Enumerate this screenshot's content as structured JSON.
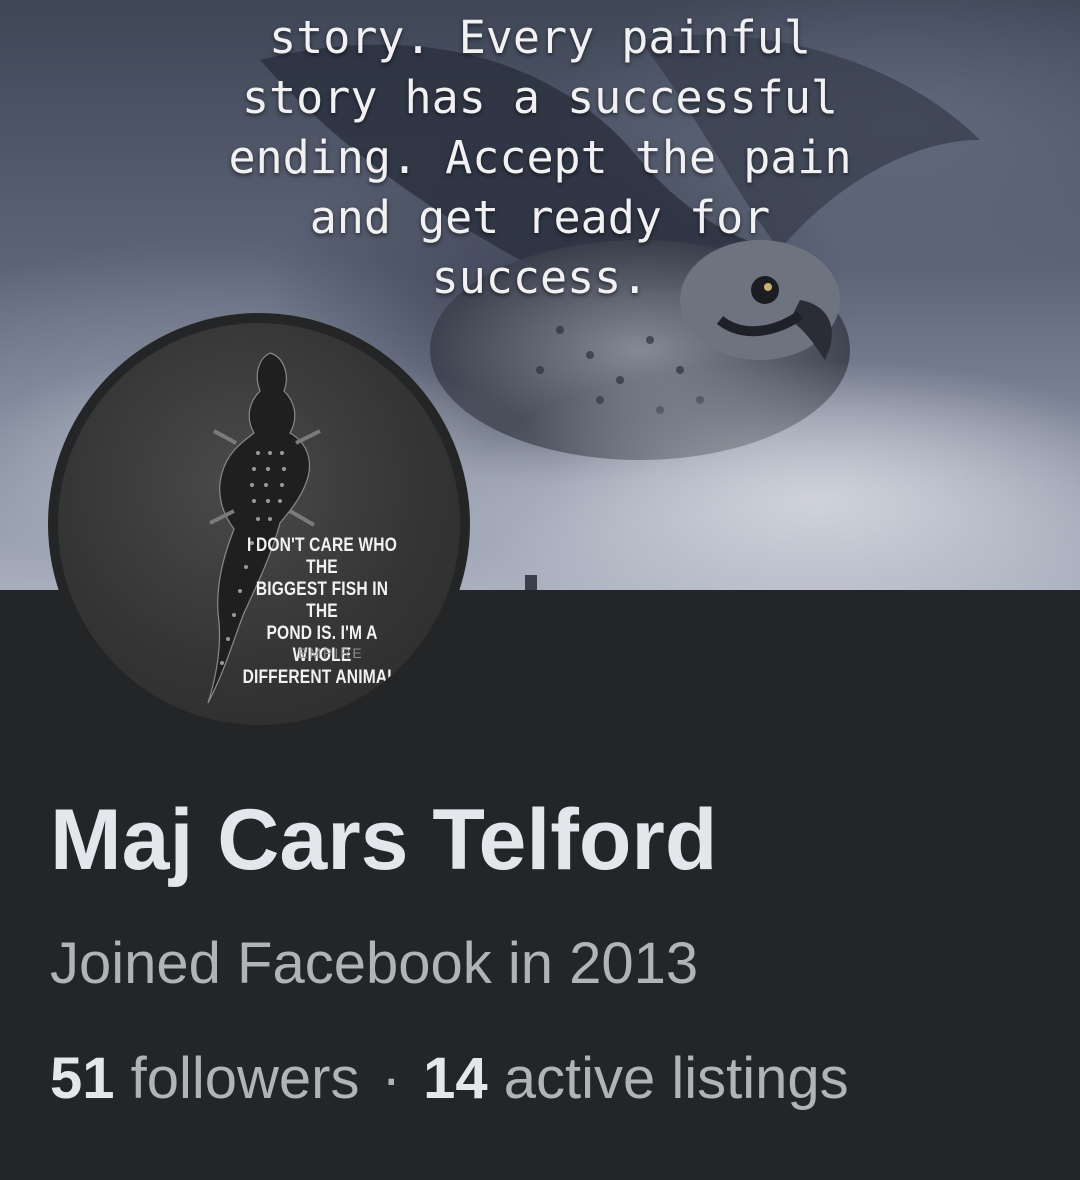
{
  "cover": {
    "quote_lines": [
      "story. Every painful",
      "story has a successful",
      "ending. Accept the pain",
      "and get ready for",
      "success."
    ]
  },
  "avatar": {
    "text_lines": [
      "I DON'T CARE WHO THE",
      "BIGGEST FISH IN THE",
      "POND IS. I'M A WHOLE",
      "DIFFERENT ANIMAL."
    ],
    "brand": "EMPIRE"
  },
  "profile": {
    "name": "Maj Cars Telford",
    "joined": "Joined Facebook in 2013",
    "followers_count": "51",
    "followers_label": "followers",
    "separator": "·",
    "listings_count": "14",
    "listings_label": "active listings"
  },
  "colors": {
    "background": "#242526",
    "primary_text": "#e4e6eb",
    "secondary_text": "#b0b3b8"
  }
}
